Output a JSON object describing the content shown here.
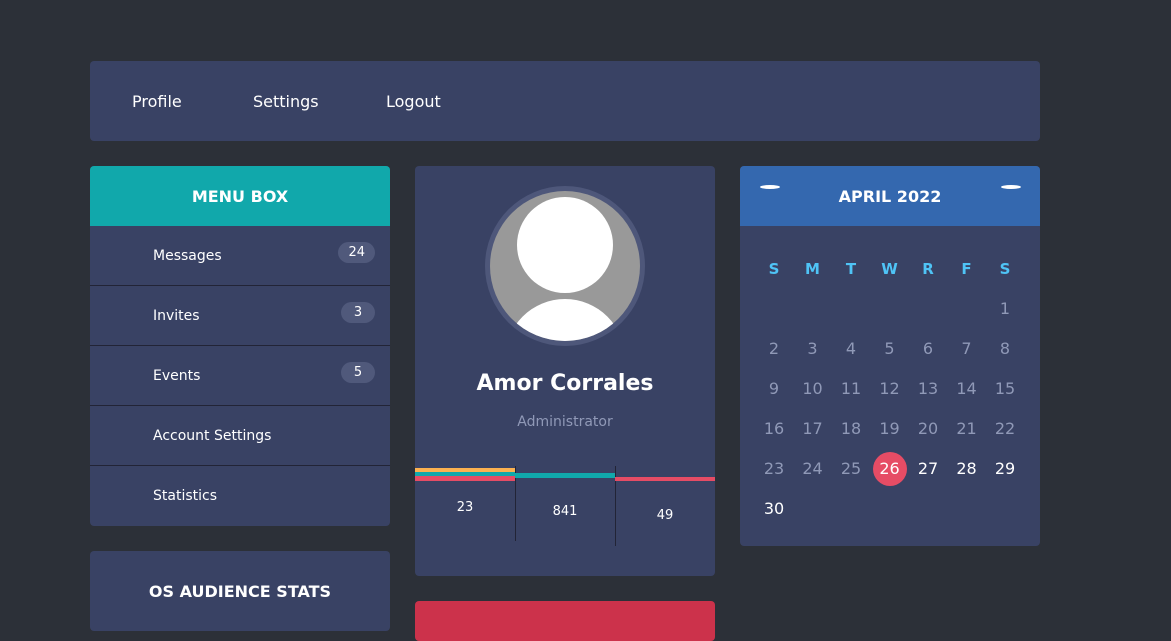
{
  "nav": {
    "items": [
      "Profile",
      "Settings",
      "Logout"
    ]
  },
  "menu_box": {
    "title": "MENU BOX",
    "items": [
      {
        "label": "Messages",
        "badge": "24"
      },
      {
        "label": "Invites",
        "badge": "3"
      },
      {
        "label": "Events",
        "badge": "5"
      },
      {
        "label": "Account Settings",
        "badge": ""
      },
      {
        "label": "Statistics",
        "badge": ""
      }
    ]
  },
  "os_audience": {
    "title": "OS AUDIENCE STATS"
  },
  "profile": {
    "name": "Amor Corrales",
    "role": "Administrator",
    "stats": [
      {
        "value": "23",
        "colors": [
          "#fcb150",
          "#11a8ab",
          "#e64c65"
        ]
      },
      {
        "value": "841",
        "colors": [
          "#11a8ab"
        ]
      },
      {
        "value": "49",
        "colors": [
          "#e64c65"
        ]
      }
    ]
  },
  "calendar": {
    "title": "APRIL 2022",
    "weekdays": [
      "S",
      "M",
      "T",
      "W",
      "R",
      "F",
      "S"
    ],
    "first_weekday_index": 6,
    "days_in_month": 30,
    "today": 26
  },
  "colors": {
    "background": "#2c3038",
    "panel": "#394264",
    "menu_header": "#11a8ab",
    "calendar_header": "#3468af",
    "today_highlight": "#e64c65",
    "weekday_text": "#4fc4f6",
    "red_card": "#cc324b"
  }
}
